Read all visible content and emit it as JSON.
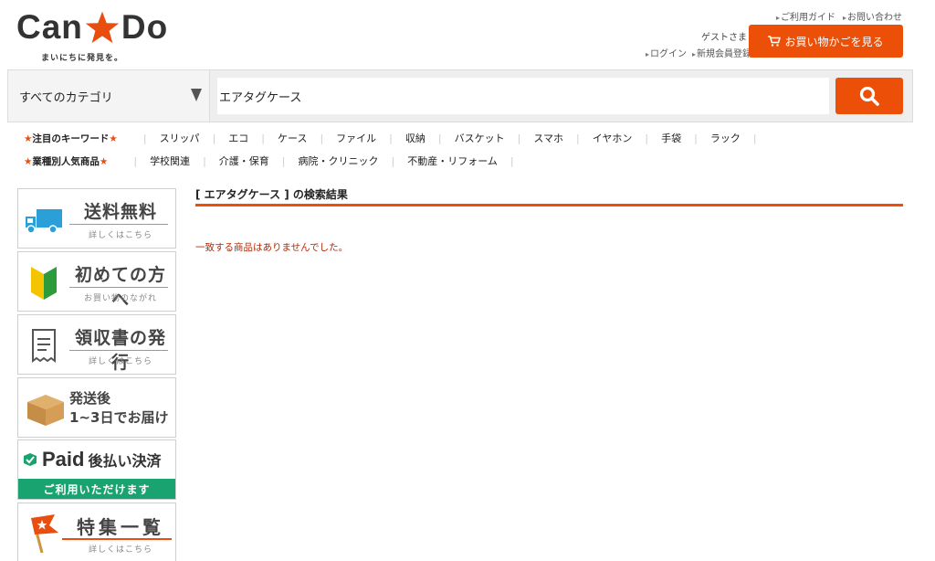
{
  "header": {
    "logo_left": "Can",
    "logo_right": "Do",
    "tagline": "まいにちに発見を。",
    "top_links": [
      "ご利用ガイド",
      "お問い合わせ"
    ],
    "guest": "ゲストさま",
    "auth_links": [
      "ログイン",
      "新規会員登録"
    ],
    "cart_label": "お買い物かごを見る"
  },
  "search": {
    "category": "すべてのカテゴリ",
    "query": "エアタグケース"
  },
  "keywords": {
    "label": "注目のキーワード",
    "items": [
      "スリッパ",
      "エコ",
      "ケース",
      "ファイル",
      "収納",
      "バスケット",
      "スマホ",
      "イヤホン",
      "手袋",
      "ラック"
    ]
  },
  "industry": {
    "label": "業種別人気商品",
    "items": [
      "学校関連",
      "介護・保育",
      "病院・クリニック",
      "不動産・リフォーム"
    ]
  },
  "sidebar": {
    "free_shipping": {
      "title": "送料無料",
      "sub": "詳しくはこちら"
    },
    "first_time": {
      "title": "初めての方へ",
      "sub": "お買い物のながれ"
    },
    "receipt": {
      "title": "領収書の発行",
      "sub": "詳しくはこちら"
    },
    "delivery": {
      "line1": "発送後",
      "line2": "1~3日でお届け"
    },
    "paid": {
      "logo": "Paid",
      "title": "後払い決済",
      "sub": "ご利用いただけます"
    },
    "features": {
      "title": "特集一覧",
      "sub": "詳しくはこちら"
    }
  },
  "main": {
    "result_title": "[ エアタグケース ] の検索結果",
    "no_result": "一致する商品はありませんでした。"
  },
  "colors": {
    "accent": "#ec5008",
    "paid_green": "#19a371",
    "error_text": "#b22b0a"
  }
}
